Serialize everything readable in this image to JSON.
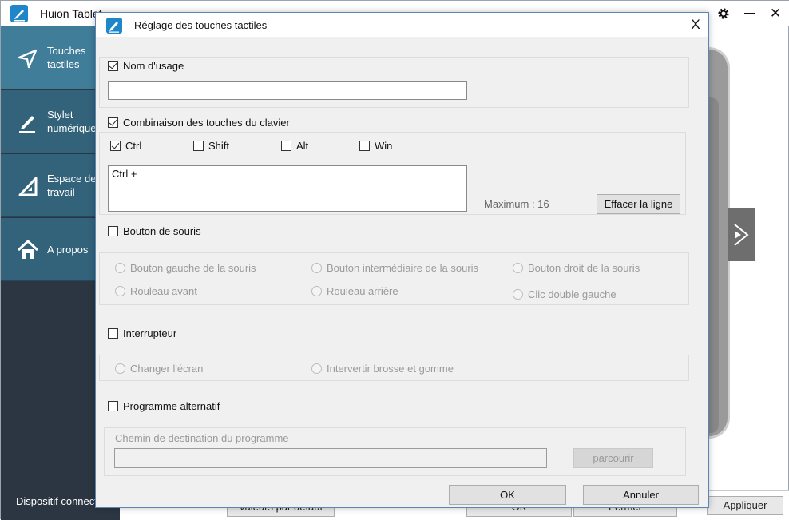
{
  "app": {
    "title": "Huion Tablet",
    "sidebar": [
      {
        "label": "Touches tactiles",
        "icon": "send-arrow-icon"
      },
      {
        "label": "Stylet numérique",
        "icon": "pen-icon"
      },
      {
        "label": "Espace de travail",
        "icon": "set-square-icon"
      },
      {
        "label": "A propos",
        "icon": "home-icon"
      }
    ],
    "device_status": "Dispositif connecté",
    "bottom_buttons": {
      "restore": "Valeurs par défaut",
      "ok": "OK",
      "close": "Fermer",
      "apply": "Appliquer"
    }
  },
  "dialog": {
    "title": "Réglage des touches tactiles",
    "close": "X",
    "usage_name": {
      "label": "Nom d'usage",
      "checked": true,
      "value": ""
    },
    "keyboard": {
      "label": "Combinaison des touches du clavier",
      "checked": true,
      "modifiers": [
        {
          "label": "Ctrl",
          "checked": true
        },
        {
          "label": "Shift",
          "checked": false
        },
        {
          "label": "Alt",
          "checked": false
        },
        {
          "label": "Win",
          "checked": false
        }
      ],
      "combo_text": "Ctrl +",
      "max_text": "Maximum : 16",
      "clear_button": "Effacer la ligne"
    },
    "mouse": {
      "label": "Bouton de souris",
      "checked": false,
      "options": [
        "Bouton gauche de la souris",
        "Bouton intermédiaire de la souris",
        "Bouton droit de la souris",
        "Rouleau avant",
        "Rouleau arrière",
        "Clic double gauche"
      ]
    },
    "switch": {
      "label": "Interrupteur",
      "checked": false,
      "options": [
        "Changer l'écran",
        "Intervertir brosse et gomme"
      ]
    },
    "program": {
      "label": "Programme alternatif",
      "checked": false,
      "path_label": "Chemin de destination du programme",
      "path_value": "",
      "browse_button": "parcourir"
    },
    "ok_button": "OK",
    "cancel_button": "Annuler"
  }
}
